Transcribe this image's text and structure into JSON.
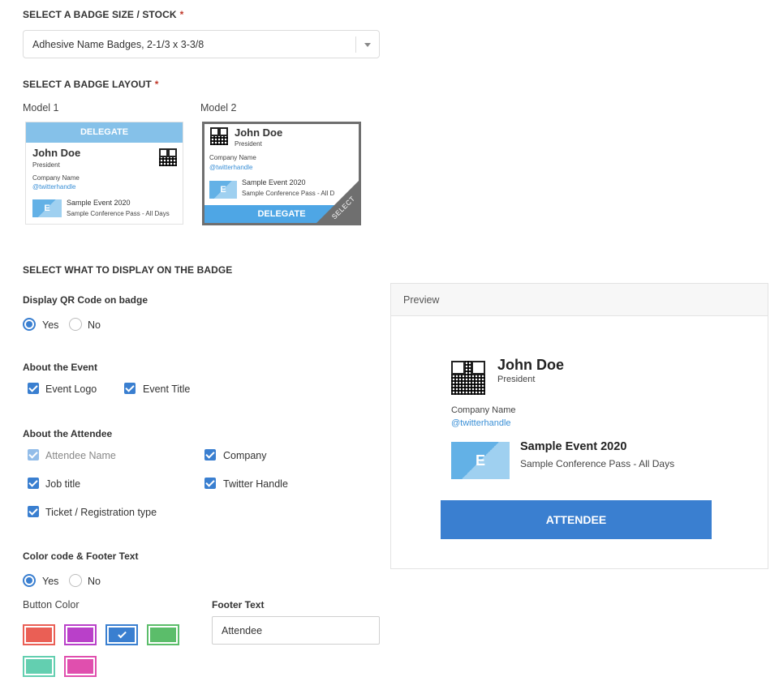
{
  "stock": {
    "title": "SELECT A BADGE SIZE / STOCK",
    "required_mark": "*",
    "selected": "Adhesive Name Badges, 2-1/3 x 3-3/8"
  },
  "layout": {
    "title": "SELECT A BADGE LAYOUT",
    "required_mark": "*",
    "models": [
      {
        "label": "Model 1",
        "bar_text": "DELEGATE",
        "name": "John Doe",
        "job": "President",
        "company": "Company Name",
        "twitter": "@twitterhandle",
        "logo_letter": "E",
        "event_title": "Sample Event 2020",
        "ticket": "Sample Conference Pass - All Days"
      },
      {
        "label": "Model 2",
        "bar_text": "DELEGATE",
        "name": "John Doe",
        "job": "President",
        "company": "Company Name",
        "twitter": "@twitterhandle",
        "logo_letter": "E",
        "event_title": "Sample Event 2020",
        "ticket": "Sample Conference Pass - All D",
        "corner_text": "SELECT"
      }
    ]
  },
  "display": {
    "title": "SELECT WHAT TO DISPLAY ON THE BADGE",
    "qr": {
      "label": "Display QR Code on badge",
      "yes": "Yes",
      "no": "No",
      "value": "yes"
    },
    "event": {
      "label": "About the Event",
      "options": [
        {
          "label": "Event Logo",
          "checked": true
        },
        {
          "label": "Event Title",
          "checked": true
        }
      ]
    },
    "attendee": {
      "label": "About the Attendee",
      "options": [
        {
          "label": "Attendee Name",
          "checked": true,
          "disabled": true
        },
        {
          "label": "Company",
          "checked": true
        },
        {
          "label": "Job title",
          "checked": true
        },
        {
          "label": "Twitter Handle",
          "checked": true
        },
        {
          "label": "Ticket / Registration type",
          "checked": true
        }
      ]
    },
    "color_code": {
      "label": "Color code & Footer Text",
      "yes": "Yes",
      "no": "No",
      "value": "yes"
    },
    "button_color": {
      "label": "Button Color",
      "swatches": [
        {
          "color": "#ea5f55",
          "selected": false
        },
        {
          "color": "#b940c9",
          "selected": false
        },
        {
          "color": "#3a7fd0",
          "selected": true
        },
        {
          "color": "#5bbd6a",
          "selected": false
        },
        {
          "color": "#63cfb0",
          "selected": false
        },
        {
          "color": "#e04fae",
          "selected": false
        }
      ]
    },
    "footer_text": {
      "label": "Footer Text",
      "value": "Attendee"
    }
  },
  "preview": {
    "header": "Preview",
    "name": "John Doe",
    "job": "President",
    "company": "Company Name",
    "twitter": "@twitterhandle",
    "logo_letter": "E",
    "event_title": "Sample Event 2020",
    "ticket": "Sample Conference Pass - All Days",
    "footer_button": "ATTENDEE"
  },
  "colors": {
    "accent": "#3a7fd0",
    "link": "#3a8fd6",
    "required": "#c0392b"
  }
}
